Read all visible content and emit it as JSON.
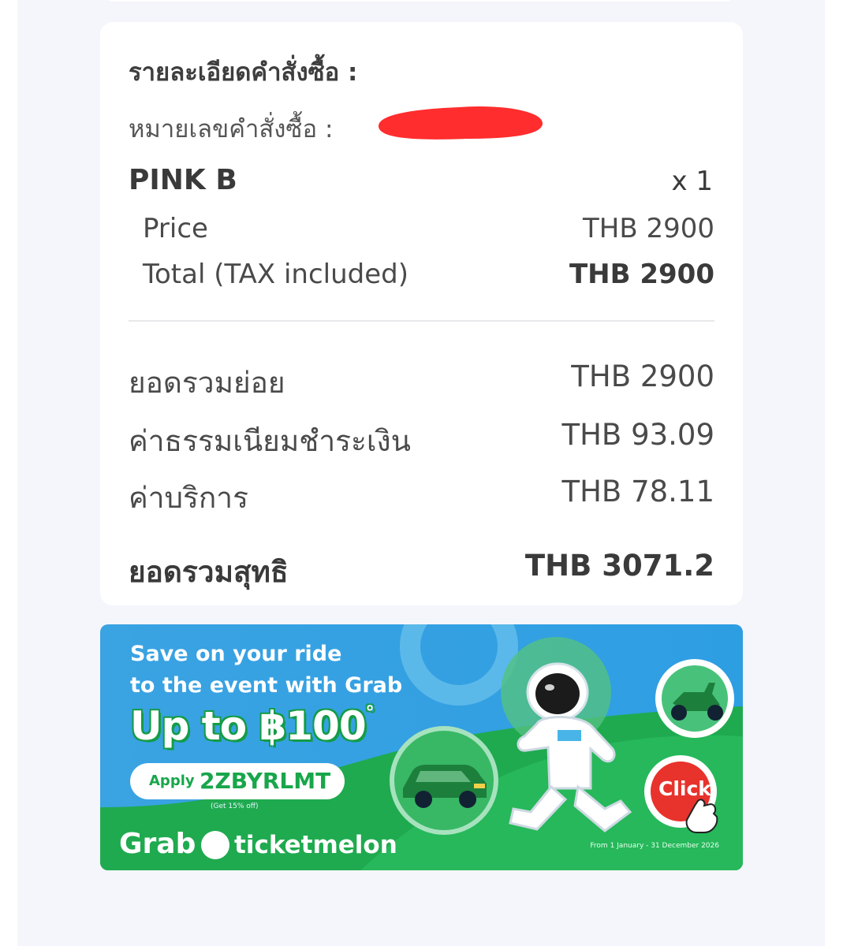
{
  "order": {
    "section_title": "รายละเอียดคำสั่งซื้อ :",
    "order_number_label": "หมายเลขคำสั่งซื้อ :",
    "item": {
      "name": "PINK B",
      "quantity": "x 1",
      "price_label": "Price",
      "price_value": "THB 2900",
      "total_label": "Total (TAX included)",
      "total_value": "THB 2900"
    },
    "summary": {
      "subtotal_label": "ยอดรวมย่อย",
      "subtotal_value": "THB 2900",
      "payment_fee_label": "ค่าธรรมเนียมชำระเงิน",
      "payment_fee_value": "THB 93.09",
      "service_fee_label": "ค่าบริการ",
      "service_fee_value": "THB 78.11",
      "net_total_label": "ยอดรวมสุทธิ",
      "net_total_value": "THB 3071.2"
    }
  },
  "banner": {
    "line1": "Save on your ride",
    "line2": "to the event with Grab",
    "headline": "Up to ฿100",
    "headline_mark": "°",
    "apply_label": "Apply",
    "promo_code": "2ZBYRLMT",
    "promo_note": "(Get 15% off)",
    "brand_grab": "Grab",
    "brand_ticketmelon": "ticketmelon",
    "date_note": "From 1 January - 31 December 2026",
    "click_label": "Click"
  },
  "colors": {
    "banner_blue": "#2f9fe0",
    "grab_green": "#18a64a",
    "redaction_red": "#ff2d2d",
    "click_red": "#e8322c"
  },
  "icons": [
    "astronaut-illustration",
    "car-icon",
    "scooter-icon",
    "hand-pointer-icon",
    "ticketmelon-logo-icon"
  ]
}
